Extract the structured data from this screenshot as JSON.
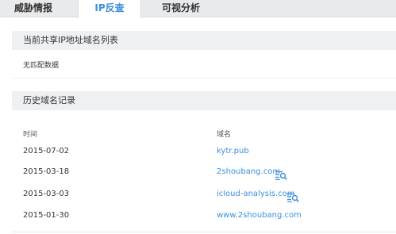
{
  "tabs": [
    {
      "label": "威胁情报",
      "active": false
    },
    {
      "label": "IP反查",
      "active": true
    },
    {
      "label": "可视分析",
      "active": false
    }
  ],
  "shared_section": {
    "title": "当前共享IP地址域名列表",
    "empty_text": "无匹配数据"
  },
  "history_section": {
    "title": "历史域名记录",
    "columns": {
      "time": "时间",
      "domain": "域名"
    },
    "rows": [
      {
        "date": "2015-07-02",
        "domain": "kytr.pub",
        "has_lookup": false
      },
      {
        "date": "2015-03-18",
        "domain": "2shoubang.com",
        "has_lookup": true
      },
      {
        "date": "2015-03-03",
        "domain": "icloud-analysis.com",
        "has_lookup": true
      },
      {
        "date": "2015-01-30",
        "domain": "www.2shoubang.com",
        "has_lookup": false
      }
    ]
  },
  "colors": {
    "accent": "#3b8fdd",
    "section_bg": "#eef0f2",
    "tabbar_bg": "#e9eaec"
  }
}
